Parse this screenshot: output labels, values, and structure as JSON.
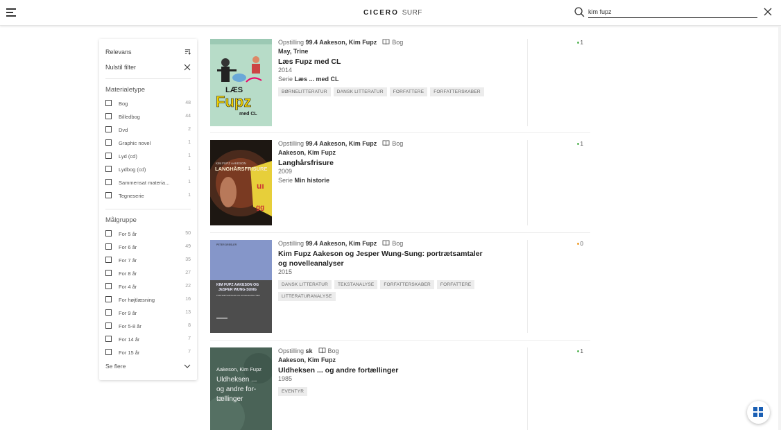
{
  "header": {
    "logo_main": "CICERO",
    "logo_sub": "SURF",
    "search_value": "kim fupz"
  },
  "filters": {
    "sort_label": "Relevans",
    "reset_label": "Nulstil filter",
    "material_heading": "Materialetype",
    "material": [
      {
        "label": "Bog",
        "count": "48"
      },
      {
        "label": "Billedbog",
        "count": "44"
      },
      {
        "label": "Dvd",
        "count": "2"
      },
      {
        "label": "Graphic novel",
        "count": "1"
      },
      {
        "label": "Lyd (cd)",
        "count": "1"
      },
      {
        "label": "Lydbog (cd)",
        "count": "1"
      },
      {
        "label": "Sammensat materia...",
        "count": "1"
      },
      {
        "label": "Tegneserie",
        "count": "1"
      }
    ],
    "target_heading": "Målgruppe",
    "target": [
      {
        "label": "For 5 år",
        "count": "50"
      },
      {
        "label": "For 6 år",
        "count": "49"
      },
      {
        "label": "For 7 år",
        "count": "35"
      },
      {
        "label": "For 8 år",
        "count": "27"
      },
      {
        "label": "For 4 år",
        "count": "22"
      },
      {
        "label": "For højtlæsning",
        "count": "16"
      },
      {
        "label": "For 9 år",
        "count": "13"
      },
      {
        "label": "For 5-8 år",
        "count": "8"
      },
      {
        "label": "For 14 år",
        "count": "7"
      },
      {
        "label": "For 15 år",
        "count": "7"
      }
    ],
    "see_more_label": "Se flere"
  },
  "results": [
    {
      "placement_label": "Opstilling",
      "placement": "99.4 Aakeson, Kim Fupz",
      "material": "Bog",
      "authors": "May, Trine",
      "title": "Læs Fupz med CL",
      "year": "2014",
      "serie_label": "Serie",
      "serie": "Læs ... med CL",
      "tags": [
        "BØRNELITTERATUR",
        "DANSK LITTERATUR",
        "FORFATTERE",
        "FORFATTERSKABER"
      ],
      "availability": "1",
      "avail_color": "#5cb85c",
      "cover_text_top": "LÆS",
      "cover_text_main": "Fupz",
      "cover_text_sub": "med CL"
    },
    {
      "placement_label": "Opstilling",
      "placement": "99.4 Aakeson, Kim Fupz",
      "material": "Bog",
      "authors": "Aakeson, Kim Fupz",
      "title": "Langhårsfrisure",
      "year": "2009",
      "serie_label": "Serie",
      "serie": "Min historie",
      "tags": [],
      "availability": "1",
      "avail_color": "#5cb85c",
      "cover_text_top": "KIM FUPZ AAKESON",
      "cover_text_main": "LANGHÅRSFRISURE"
    },
    {
      "placement_label": "Opstilling",
      "placement": "99.4 Aakeson, Kim Fupz",
      "material": "Bog",
      "authors": "",
      "title": "Kim Fupz Aakeson og Jesper Wung-Sung: portrætsamtaler og novelleanalyser",
      "year": "2015",
      "tags": [
        "DANSK LITTERATUR",
        "TEKSTANALYSE",
        "FORFATTERSKABER",
        "FORFATTERE",
        "LITTERATURANALYSE"
      ],
      "availability": "0",
      "avail_color": "#f0a030",
      "cover_text_top": "PETER DRESLER",
      "cover_text_main": "KIM FUPZ AAKESON OG JESPER WUNG-SUNG",
      "cover_text_sub": "PORTRÆTSAMTALER OG NOVELLEANALYSER"
    },
    {
      "placement_label": "Opstilling",
      "placement": "sk",
      "material": "Bog",
      "authors": "Aakeson, Kim Fupz",
      "title": "Uldheksen ... og andre fortællinger",
      "year": "1985",
      "tags": [
        "EVENTYR"
      ],
      "availability": "1",
      "avail_color": "#5cb85c",
      "cover_text_top": "Aakeson, Kim Fupz",
      "cover_text_main": "Uldheksen ... og andre for- tællinger"
    }
  ]
}
